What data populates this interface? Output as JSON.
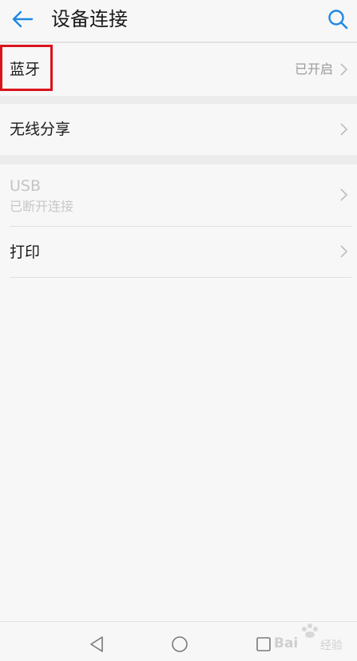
{
  "header": {
    "title": "设备连接",
    "back_icon": "arrow-left-icon",
    "search_icon": "search-icon",
    "accent_color": "#1e88e5"
  },
  "settings": {
    "bluetooth": {
      "label": "蓝牙",
      "status": "已开启"
    },
    "wireless_share": {
      "label": "无线分享"
    },
    "usb": {
      "label": "USB",
      "sublabel": "已断开连接"
    },
    "print": {
      "label": "打印"
    }
  },
  "annotation": {
    "highlight_color": "#d9141b"
  },
  "nav": {
    "back_icon": "triangle-back-icon",
    "home_icon": "circle-home-icon",
    "recents_icon": "square-recents-icon"
  },
  "watermark": {
    "text": "Bai",
    "cn": "经验"
  }
}
